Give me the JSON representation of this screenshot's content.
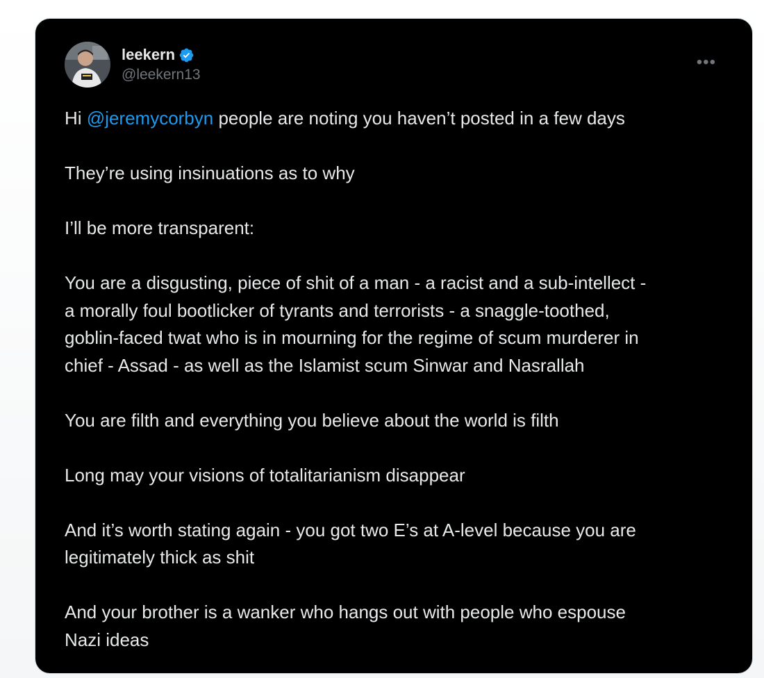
{
  "tweet": {
    "display_name": "leekern",
    "handle": "@leekern13",
    "more_icon": "more-horizontal-icon",
    "verified_icon": "verified-badge-icon",
    "colors": {
      "background": "#000000",
      "text": "#e7e9ea",
      "muted": "#71767b",
      "link": "#1d9bf0",
      "verified": "#1d9bf0"
    },
    "body": {
      "p1_prefix": "Hi ",
      "p1_mention": "@jeremycorbyn",
      "p1_suffix": " people are noting you haven’t posted in a few days",
      "p2": "They’re using insinuations as to why",
      "p3": "I’ll be more transparent:",
      "p4_l1": "You are a disgusting, piece of shit of a man - a racist and a sub-intellect -",
      "p4_l2": "a morally foul bootlicker of tyrants and terrorists - a snaggle-toothed,",
      "p4_l3": "goblin-faced twat who is in mourning for the regime of scum murderer in",
      "p4_l4": "chief - Assad - as well as the Islamist scum Sinwar and Nasrallah",
      "p5": "You are filth and everything you believe about the world is filth",
      "p6": "Long may your visions of totalitarianism disappear",
      "p7_l1": "And it’s worth stating again - you got two E’s at A-level because you are",
      "p7_l2": "legitimately thick as shit",
      "p8_l1": "And your brother is a wanker who hangs out with people who espouse",
      "p8_l2": "Nazi ideas"
    }
  }
}
